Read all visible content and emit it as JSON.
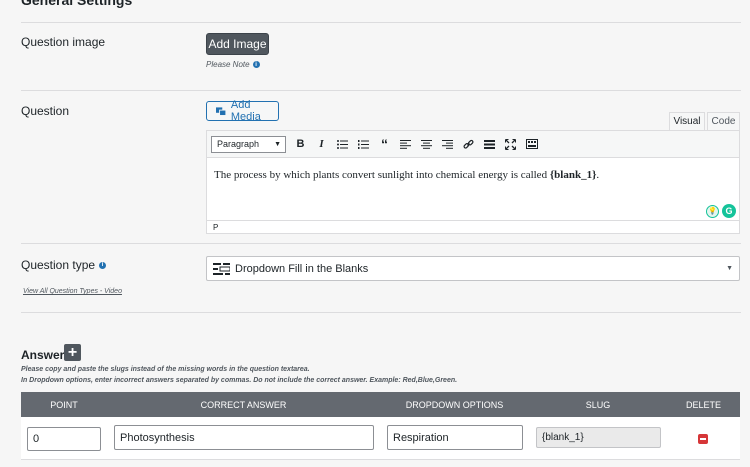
{
  "section": {
    "title": "General Settings"
  },
  "question_image": {
    "label": "Question image",
    "add_image_label": "Add Image",
    "note": "Please Note"
  },
  "question": {
    "label": "Question",
    "add_media_label": "Add Media",
    "tabs": [
      "Visual",
      "Code"
    ],
    "active_tab": "Visual",
    "format_select": "Paragraph",
    "toolbar_icons": [
      "bold-icon",
      "italic-icon",
      "bullet-list-icon",
      "numbered-list-icon",
      "blockquote-icon",
      "align-left-icon",
      "align-center-icon",
      "align-right-icon",
      "link-icon",
      "horizontal-rule-icon",
      "fullscreen-icon",
      "toolbar-toggle-icon"
    ],
    "content_prefix": "The process by which plants convert sunlight into chemical energy is called ",
    "content_blank": "{blank_1}",
    "content_suffix": ".",
    "status_path": "P"
  },
  "question_type": {
    "label": "Question type",
    "selected": "Dropdown Fill in the Blanks",
    "video_link": "View All Question Types - Video"
  },
  "answer": {
    "label": "Answer",
    "help_line1": "Please copy and paste the slugs instead of the missing words in the question textarea.",
    "help_line2": "In Dropdown options, enter incorrect answers separated by commas. Do not include the correct answer. Example: Red,Blue,Green.",
    "columns": [
      "POINT",
      "CORRECT ANSWER",
      "DROPDOWN OPTIONS",
      "SLUG",
      "DELETE"
    ],
    "rows": [
      {
        "point": "0",
        "correct": "Photosynthesis",
        "options": "Respiration",
        "slug": "{blank_1}"
      }
    ]
  },
  "colors": {
    "accent": "#2271b1",
    "header_bg": "#646970",
    "delete": "#d63638",
    "button_dark": "#50575e"
  }
}
